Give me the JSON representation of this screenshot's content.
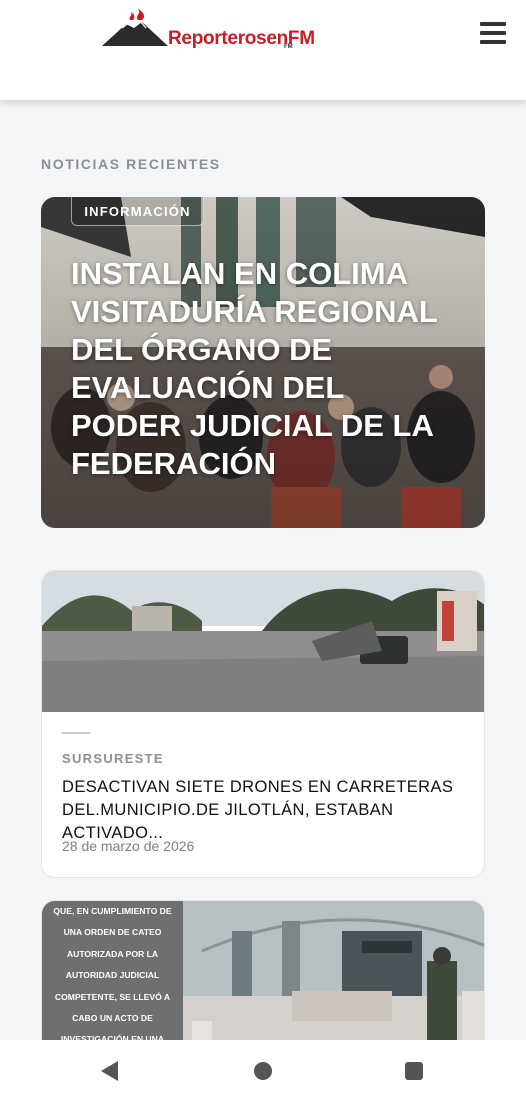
{
  "header": {
    "logo_text": "ReporterosenFM",
    "logo_sub": "FM",
    "menu_icon": "hamburger-menu-icon"
  },
  "section": {
    "heading": "NOTICIAS RECIENTES"
  },
  "featured": {
    "tag": "INFORMACIÓN",
    "headline": "INSTALAN EN COLIMA VISITADURÍA REGIONAL DEL ÓRGANO DE EVALUACIÓN DEL PODER JUDICIAL DE LA FEDERACIÓN"
  },
  "articles": [
    {
      "category": "SURSURESTE",
      "title": "DESACTIVAN SIETE DRONES EN CARRETERAS DEL.MUNICIPIO.DE JILOTLÁN, ESTABAN ACTIVADO...",
      "date": "28 de marzo de 2026"
    },
    {
      "caption": "QUE, EN CUMPLIMIENTO DE UNA ORDEN DE CATEO AUTORIZADA POR LA AUTORIDAD JUDICIAL COMPETENTE, SE LLEVÓ A CABO UN ACTO DE INVESTIGACIÓN EN UNA"
    }
  ],
  "navbar": {
    "back_icon": "back-triangle-icon",
    "home_icon": "home-circle-icon",
    "recents_icon": "recents-square-icon"
  },
  "colors": {
    "brand_red": "#c81d25",
    "page_bg": "#f4f5f7",
    "muted_text": "#8a8f98"
  }
}
